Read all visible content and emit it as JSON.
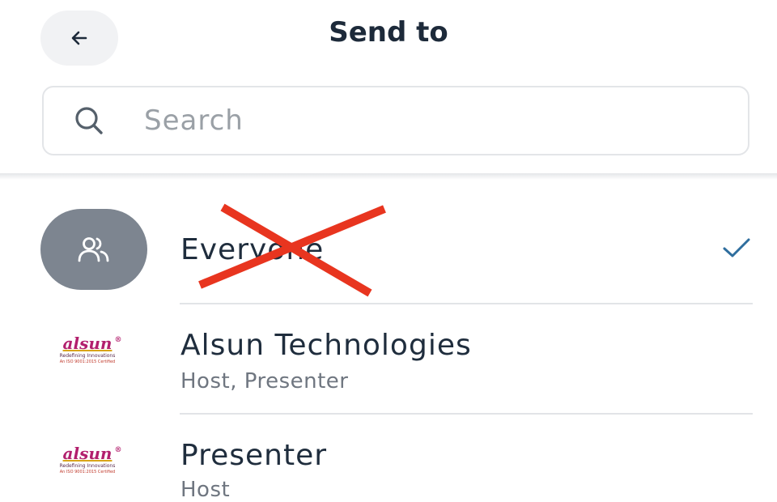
{
  "header": {
    "title": "Send to"
  },
  "search": {
    "placeholder": "Search",
    "value": ""
  },
  "recipients": [
    {
      "name": "Everyone",
      "avatar": "people-group-icon",
      "selected": true,
      "crossed_out": true
    },
    {
      "name": "Alsun  Technologies",
      "subtitle": "Host, Presenter",
      "logo": {
        "word": "alsun",
        "registered": "®",
        "tagline": "Redefining Innovations",
        "certification": "An ISO 9001:2015 Certified"
      }
    },
    {
      "name": "Presenter",
      "subtitle": "Host",
      "logo": {
        "word": "alsun",
        "registered": "®",
        "tagline": "Redefining Innovations",
        "certification": "An ISO 9001:2015 Certified"
      }
    }
  ],
  "colors": {
    "accent": "#2f6e9e",
    "strike": "#e8351f",
    "avatar_bg": "#7d8590",
    "logo": "#b21f6d"
  }
}
